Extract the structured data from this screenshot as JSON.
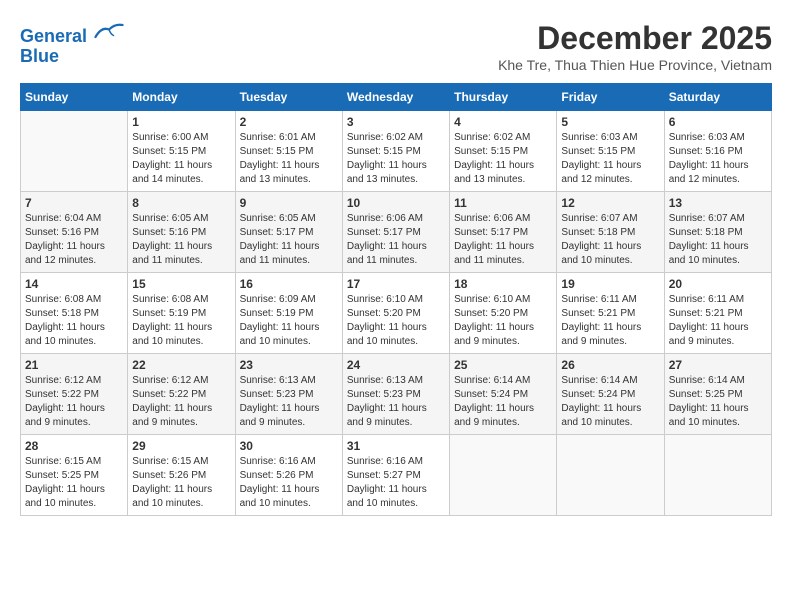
{
  "logo": {
    "line1": "General",
    "line2": "Blue"
  },
  "title": "December 2025",
  "subtitle": "Khe Tre, Thua Thien Hue Province, Vietnam",
  "days": [
    "Sunday",
    "Monday",
    "Tuesday",
    "Wednesday",
    "Thursday",
    "Friday",
    "Saturday"
  ],
  "weeks": [
    [
      {
        "day": "",
        "content": ""
      },
      {
        "day": "1",
        "content": "Sunrise: 6:00 AM\nSunset: 5:15 PM\nDaylight: 11 hours\nand 14 minutes."
      },
      {
        "day": "2",
        "content": "Sunrise: 6:01 AM\nSunset: 5:15 PM\nDaylight: 11 hours\nand 13 minutes."
      },
      {
        "day": "3",
        "content": "Sunrise: 6:02 AM\nSunset: 5:15 PM\nDaylight: 11 hours\nand 13 minutes."
      },
      {
        "day": "4",
        "content": "Sunrise: 6:02 AM\nSunset: 5:15 PM\nDaylight: 11 hours\nand 13 minutes."
      },
      {
        "day": "5",
        "content": "Sunrise: 6:03 AM\nSunset: 5:15 PM\nDaylight: 11 hours\nand 12 minutes."
      },
      {
        "day": "6",
        "content": "Sunrise: 6:03 AM\nSunset: 5:16 PM\nDaylight: 11 hours\nand 12 minutes."
      }
    ],
    [
      {
        "day": "7",
        "content": "Sunrise: 6:04 AM\nSunset: 5:16 PM\nDaylight: 11 hours\nand 12 minutes."
      },
      {
        "day": "8",
        "content": "Sunrise: 6:05 AM\nSunset: 5:16 PM\nDaylight: 11 hours\nand 11 minutes."
      },
      {
        "day": "9",
        "content": "Sunrise: 6:05 AM\nSunset: 5:17 PM\nDaylight: 11 hours\nand 11 minutes."
      },
      {
        "day": "10",
        "content": "Sunrise: 6:06 AM\nSunset: 5:17 PM\nDaylight: 11 hours\nand 11 minutes."
      },
      {
        "day": "11",
        "content": "Sunrise: 6:06 AM\nSunset: 5:17 PM\nDaylight: 11 hours\nand 11 minutes."
      },
      {
        "day": "12",
        "content": "Sunrise: 6:07 AM\nSunset: 5:18 PM\nDaylight: 11 hours\nand 10 minutes."
      },
      {
        "day": "13",
        "content": "Sunrise: 6:07 AM\nSunset: 5:18 PM\nDaylight: 11 hours\nand 10 minutes."
      }
    ],
    [
      {
        "day": "14",
        "content": "Sunrise: 6:08 AM\nSunset: 5:18 PM\nDaylight: 11 hours\nand 10 minutes."
      },
      {
        "day": "15",
        "content": "Sunrise: 6:08 AM\nSunset: 5:19 PM\nDaylight: 11 hours\nand 10 minutes."
      },
      {
        "day": "16",
        "content": "Sunrise: 6:09 AM\nSunset: 5:19 PM\nDaylight: 11 hours\nand 10 minutes."
      },
      {
        "day": "17",
        "content": "Sunrise: 6:10 AM\nSunset: 5:20 PM\nDaylight: 11 hours\nand 10 minutes."
      },
      {
        "day": "18",
        "content": "Sunrise: 6:10 AM\nSunset: 5:20 PM\nDaylight: 11 hours\nand 9 minutes."
      },
      {
        "day": "19",
        "content": "Sunrise: 6:11 AM\nSunset: 5:21 PM\nDaylight: 11 hours\nand 9 minutes."
      },
      {
        "day": "20",
        "content": "Sunrise: 6:11 AM\nSunset: 5:21 PM\nDaylight: 11 hours\nand 9 minutes."
      }
    ],
    [
      {
        "day": "21",
        "content": "Sunrise: 6:12 AM\nSunset: 5:22 PM\nDaylight: 11 hours\nand 9 minutes."
      },
      {
        "day": "22",
        "content": "Sunrise: 6:12 AM\nSunset: 5:22 PM\nDaylight: 11 hours\nand 9 minutes."
      },
      {
        "day": "23",
        "content": "Sunrise: 6:13 AM\nSunset: 5:23 PM\nDaylight: 11 hours\nand 9 minutes."
      },
      {
        "day": "24",
        "content": "Sunrise: 6:13 AM\nSunset: 5:23 PM\nDaylight: 11 hours\nand 9 minutes."
      },
      {
        "day": "25",
        "content": "Sunrise: 6:14 AM\nSunset: 5:24 PM\nDaylight: 11 hours\nand 9 minutes."
      },
      {
        "day": "26",
        "content": "Sunrise: 6:14 AM\nSunset: 5:24 PM\nDaylight: 11 hours\nand 10 minutes."
      },
      {
        "day": "27",
        "content": "Sunrise: 6:14 AM\nSunset: 5:25 PM\nDaylight: 11 hours\nand 10 minutes."
      }
    ],
    [
      {
        "day": "28",
        "content": "Sunrise: 6:15 AM\nSunset: 5:25 PM\nDaylight: 11 hours\nand 10 minutes."
      },
      {
        "day": "29",
        "content": "Sunrise: 6:15 AM\nSunset: 5:26 PM\nDaylight: 11 hours\nand 10 minutes."
      },
      {
        "day": "30",
        "content": "Sunrise: 6:16 AM\nSunset: 5:26 PM\nDaylight: 11 hours\nand 10 minutes."
      },
      {
        "day": "31",
        "content": "Sunrise: 6:16 AM\nSunset: 5:27 PM\nDaylight: 11 hours\nand 10 minutes."
      },
      {
        "day": "",
        "content": ""
      },
      {
        "day": "",
        "content": ""
      },
      {
        "day": "",
        "content": ""
      }
    ]
  ]
}
